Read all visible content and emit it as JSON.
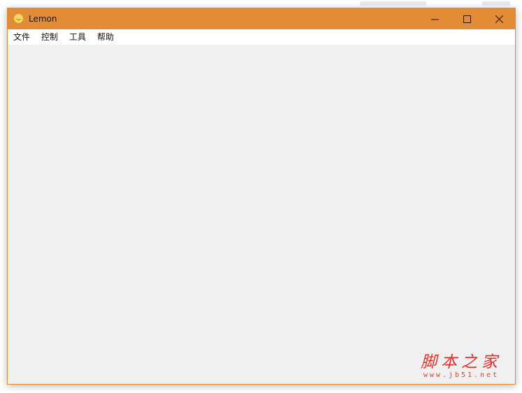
{
  "window": {
    "title": "Lemon",
    "app_icon": "lemon-icon",
    "titlebar_color": "#e38c38",
    "controls": {
      "minimize": "minimize-icon",
      "maximize": "maximize-icon",
      "close": "close-icon"
    }
  },
  "menubar": {
    "items": [
      {
        "label": "文件"
      },
      {
        "label": "控制"
      },
      {
        "label": "工具"
      },
      {
        "label": "帮助"
      }
    ]
  },
  "watermark": {
    "title": "脚本之家",
    "url": "www.jb51.net",
    "color": "#e0302d"
  }
}
